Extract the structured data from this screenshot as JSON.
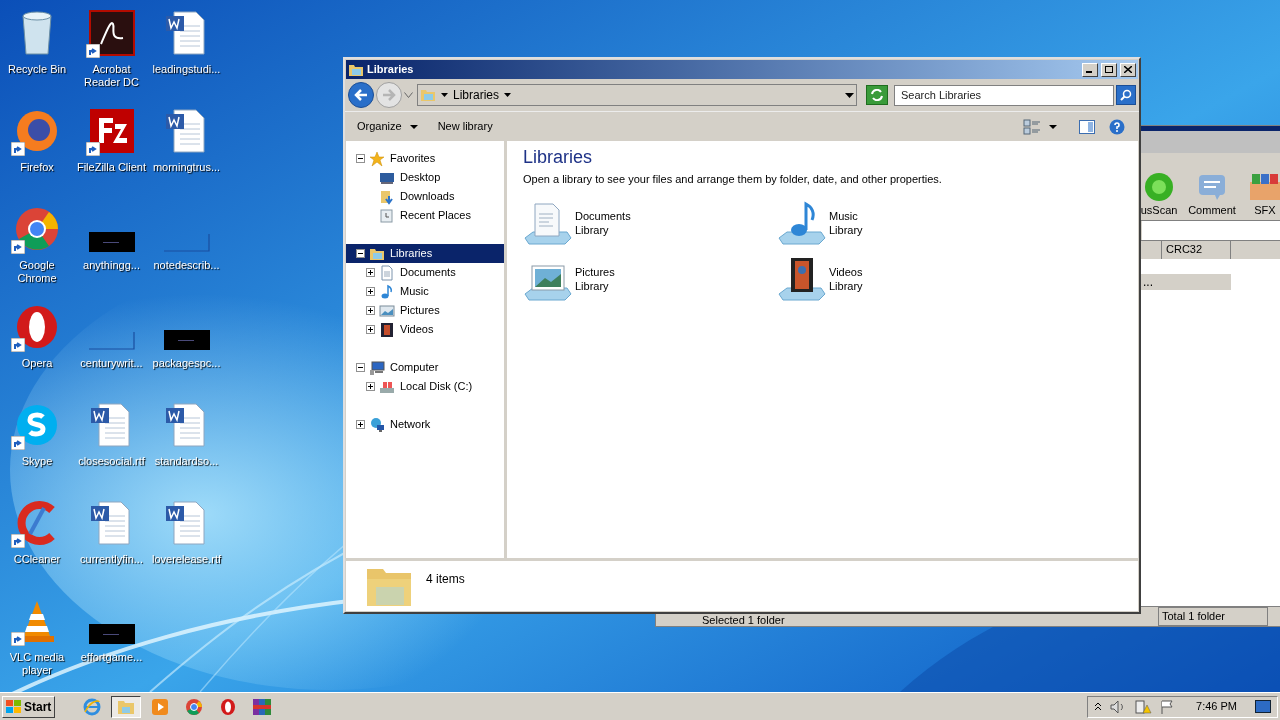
{
  "desktop_icons": [
    {
      "label": "Recycle Bin",
      "kind": "recycle",
      "shortcut": false
    },
    {
      "label": "Firefox",
      "kind": "firefox",
      "shortcut": true
    },
    {
      "label": "Google Chrome",
      "kind": "chrome",
      "shortcut": true
    },
    {
      "label": "Opera",
      "kind": "opera",
      "shortcut": true
    },
    {
      "label": "Skype",
      "kind": "skype",
      "shortcut": true
    },
    {
      "label": "CCleaner",
      "kind": "ccleaner",
      "shortcut": true
    },
    {
      "label": "VLC media player",
      "kind": "vlc",
      "shortcut": true
    },
    {
      "label": "Acrobat Reader DC",
      "kind": "pdf",
      "shortcut": true
    },
    {
      "label": "FileZilla Client",
      "kind": "filezilla",
      "shortcut": true
    },
    {
      "label": "anythingg...",
      "kind": "dark",
      "shortcut": false
    },
    {
      "label": "centurywrit...",
      "kind": "blank",
      "shortcut": false
    },
    {
      "label": "closesocial.rtf",
      "kind": "word",
      "shortcut": false
    },
    {
      "label": "currentlyfin...",
      "kind": "word",
      "shortcut": false
    },
    {
      "label": "effortgame...",
      "kind": "dark",
      "shortcut": false
    },
    {
      "label": "leadingstudi...",
      "kind": "word",
      "shortcut": false
    },
    {
      "label": "morningtrus...",
      "kind": "word",
      "shortcut": false
    },
    {
      "label": "notedescrib...",
      "kind": "blank",
      "shortcut": false
    },
    {
      "label": "packagespc...",
      "kind": "dark",
      "shortcut": false
    },
    {
      "label": "standardso...",
      "kind": "word",
      "shortcut": false
    },
    {
      "label": "loverelease.rtf",
      "kind": "word",
      "shortcut": false
    }
  ],
  "background_window": {
    "toolbar": [
      "usScan",
      "Comment",
      "SFX"
    ],
    "column": "CRC32",
    "row": "...",
    "status": [
      "Selected 1 folder",
      "Total 1 folder"
    ]
  },
  "explorer": {
    "title": "Libraries",
    "breadcrumb": [
      "Libraries"
    ],
    "search": {
      "placeholder": "Search Libraries"
    },
    "commands": [
      {
        "label": "Organize",
        "has_menu": true
      },
      {
        "label": "New library",
        "has_menu": false
      }
    ],
    "nav": [
      {
        "label": "Favorites",
        "kind": "star",
        "expanded": true,
        "selected": false,
        "children": [
          {
            "label": "Desktop",
            "kind": "desktop",
            "selected": false
          },
          {
            "label": "Downloads",
            "kind": "downloads",
            "selected": false
          },
          {
            "label": "Recent Places",
            "kind": "recent",
            "selected": false
          }
        ]
      },
      {
        "label": "Libraries",
        "kind": "library",
        "expanded": true,
        "selected": true,
        "children": [
          {
            "label": "Documents",
            "kind": "documents",
            "expanded": false,
            "selected": false
          },
          {
            "label": "Music",
            "kind": "music",
            "expanded": false,
            "selected": false
          },
          {
            "label": "Pictures",
            "kind": "pictures",
            "expanded": false,
            "selected": false
          },
          {
            "label": "Videos",
            "kind": "videos",
            "expanded": false,
            "selected": false
          }
        ]
      },
      {
        "label": "Computer",
        "kind": "computer",
        "expanded": true,
        "selected": false,
        "children": [
          {
            "label": "Local Disk (C:)",
            "kind": "disk",
            "expanded": false,
            "selected": false
          }
        ]
      },
      {
        "label": "Network",
        "kind": "network",
        "expanded": false,
        "selected": false
      }
    ],
    "heading": "Libraries",
    "description": "Open a library to see your files and arrange them by folder, date, and other properties.",
    "items": [
      {
        "name": "Documents",
        "type": "Library",
        "kind": "documents"
      },
      {
        "name": "Music",
        "type": "Library",
        "kind": "music"
      },
      {
        "name": "Pictures",
        "type": "Library",
        "kind": "pictures"
      },
      {
        "name": "Videos",
        "type": "Library",
        "kind": "videos"
      }
    ],
    "details": "4 items"
  },
  "taskbar": {
    "start": "Start",
    "apps": [
      {
        "kind": "ie",
        "selected": false
      },
      {
        "kind": "explorer",
        "selected": true
      },
      {
        "kind": "media",
        "selected": false
      },
      {
        "kind": "chrome",
        "selected": false
      },
      {
        "kind": "opera",
        "selected": false
      },
      {
        "kind": "winrar",
        "selected": false
      }
    ],
    "clock": "7:46 PM"
  }
}
